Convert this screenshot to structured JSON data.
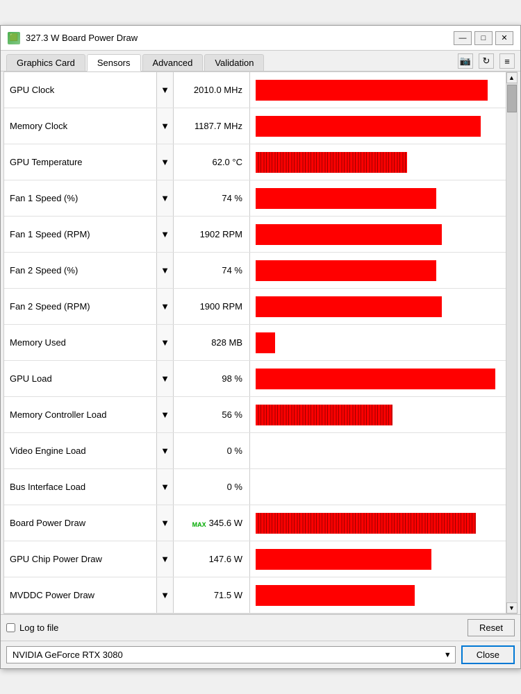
{
  "window": {
    "title": "327.3 W Board Power Draw",
    "icon": "🟩",
    "controls": {
      "minimize": "—",
      "maximize": "□",
      "close": "✕"
    }
  },
  "tabs": [
    {
      "id": "graphics-card",
      "label": "Graphics Card",
      "active": false
    },
    {
      "id": "sensors",
      "label": "Sensors",
      "active": true
    },
    {
      "id": "advanced",
      "label": "Advanced",
      "active": false
    },
    {
      "id": "validation",
      "label": "Validation",
      "active": false
    }
  ],
  "tab_actions": {
    "camera": "📷",
    "refresh": "↻",
    "menu": "≡"
  },
  "sensors": [
    {
      "name": "GPU Clock",
      "value": "2010.0 MHz",
      "bar_pct": 95,
      "has_bar": true,
      "noisy": false
    },
    {
      "name": "Memory Clock",
      "value": "1187.7 MHz",
      "bar_pct": 92,
      "has_bar": true,
      "noisy": false
    },
    {
      "name": "GPU Temperature",
      "value": "62.0 °C",
      "bar_pct": 62,
      "has_bar": true,
      "noisy": true
    },
    {
      "name": "Fan 1 Speed (%)",
      "value": "74 %",
      "bar_pct": 74,
      "has_bar": true,
      "noisy": false
    },
    {
      "name": "Fan 1 Speed (RPM)",
      "value": "1902 RPM",
      "bar_pct": 76,
      "has_bar": true,
      "noisy": false
    },
    {
      "name": "Fan 2 Speed (%)",
      "value": "74 %",
      "bar_pct": 74,
      "has_bar": true,
      "noisy": false
    },
    {
      "name": "Fan 2 Speed (RPM)",
      "value": "1900 RPM",
      "bar_pct": 76,
      "has_bar": true,
      "noisy": false
    },
    {
      "name": "Memory Used",
      "value": "828 MB",
      "bar_pct": 8,
      "has_bar": true,
      "noisy": false
    },
    {
      "name": "GPU Load",
      "value": "98 %",
      "bar_pct": 98,
      "has_bar": true,
      "noisy": false
    },
    {
      "name": "Memory Controller Load",
      "value": "56 %",
      "bar_pct": 56,
      "has_bar": true,
      "noisy": true
    },
    {
      "name": "Video Engine Load",
      "value": "0 %",
      "bar_pct": 0,
      "has_bar": false,
      "noisy": false
    },
    {
      "name": "Bus Interface Load",
      "value": "0 %",
      "bar_pct": 0,
      "has_bar": false,
      "noisy": false
    },
    {
      "name": "Board Power Draw",
      "value": "345.6 W",
      "bar_pct": 90,
      "has_bar": true,
      "noisy": true,
      "has_max": true
    },
    {
      "name": "GPU Chip Power Draw",
      "value": "147.6 W",
      "bar_pct": 72,
      "has_bar": true,
      "noisy": false
    },
    {
      "name": "MVDDC Power Draw",
      "value": "71.5 W",
      "bar_pct": 65,
      "has_bar": true,
      "noisy": false
    }
  ],
  "bottom": {
    "log_label": "Log to file",
    "reset_label": "Reset"
  },
  "footer": {
    "gpu_name": "NVIDIA GeForce RTX 3080",
    "close_label": "Close"
  }
}
